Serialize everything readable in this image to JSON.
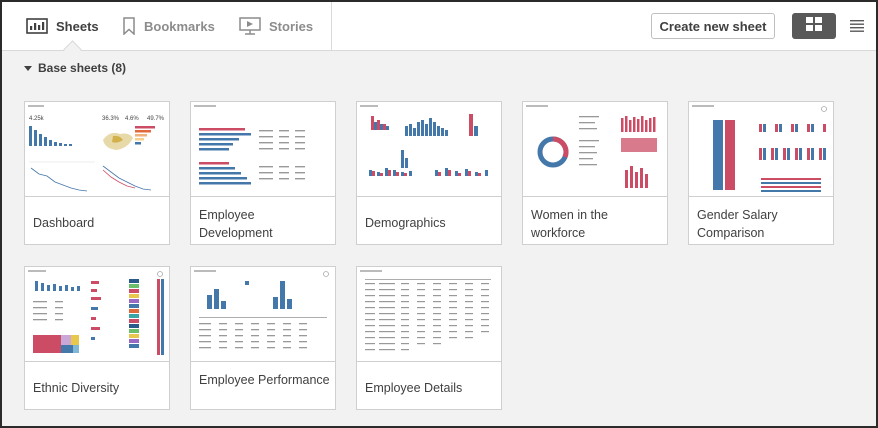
{
  "tabs": [
    {
      "label": "Sheets",
      "icon": "sheets-icon",
      "active": true
    },
    {
      "label": "Bookmarks",
      "icon": "bookmark-icon",
      "active": false
    },
    {
      "label": "Stories",
      "icon": "stories-icon",
      "active": false
    }
  ],
  "toolbar": {
    "create_label": "Create new sheet",
    "grid_view_icon": "grid-view-icon",
    "list_view_icon": "list-view-icon"
  },
  "section": {
    "title": "Base sheets (8)",
    "expanded": true
  },
  "sheets": [
    {
      "title": "Dashboard",
      "thumbnail": "dashboard-thumbnail"
    },
    {
      "title": "Employee Development",
      "thumbnail": "employee-development-thumbnail"
    },
    {
      "title": "Demographics",
      "thumbnail": "demographics-thumbnail"
    },
    {
      "title": "Women in the workforce",
      "thumbnail": "women-workforce-thumbnail"
    },
    {
      "title": "Gender Salary Comparison",
      "thumbnail": "gender-salary-thumbnail"
    },
    {
      "title": "Ethnic Diversity",
      "thumbnail": "ethnic-diversity-thumbnail"
    },
    {
      "title": "Employee Performance",
      "thumbnail": "employee-performance-thumbnail"
    },
    {
      "title": "Employee Details",
      "thumbnail": "employee-details-thumbnail"
    }
  ],
  "thumbnail_kpis": [
    "4.25k",
    "36.3%",
    "4.6%",
    "49.7%"
  ],
  "colors": {
    "accent_blue": "#4477aa",
    "accent_red": "#cc4c65",
    "active_tab": "#404040",
    "inactive_tab": "#8c8c8c",
    "grid_button": "#595959"
  }
}
